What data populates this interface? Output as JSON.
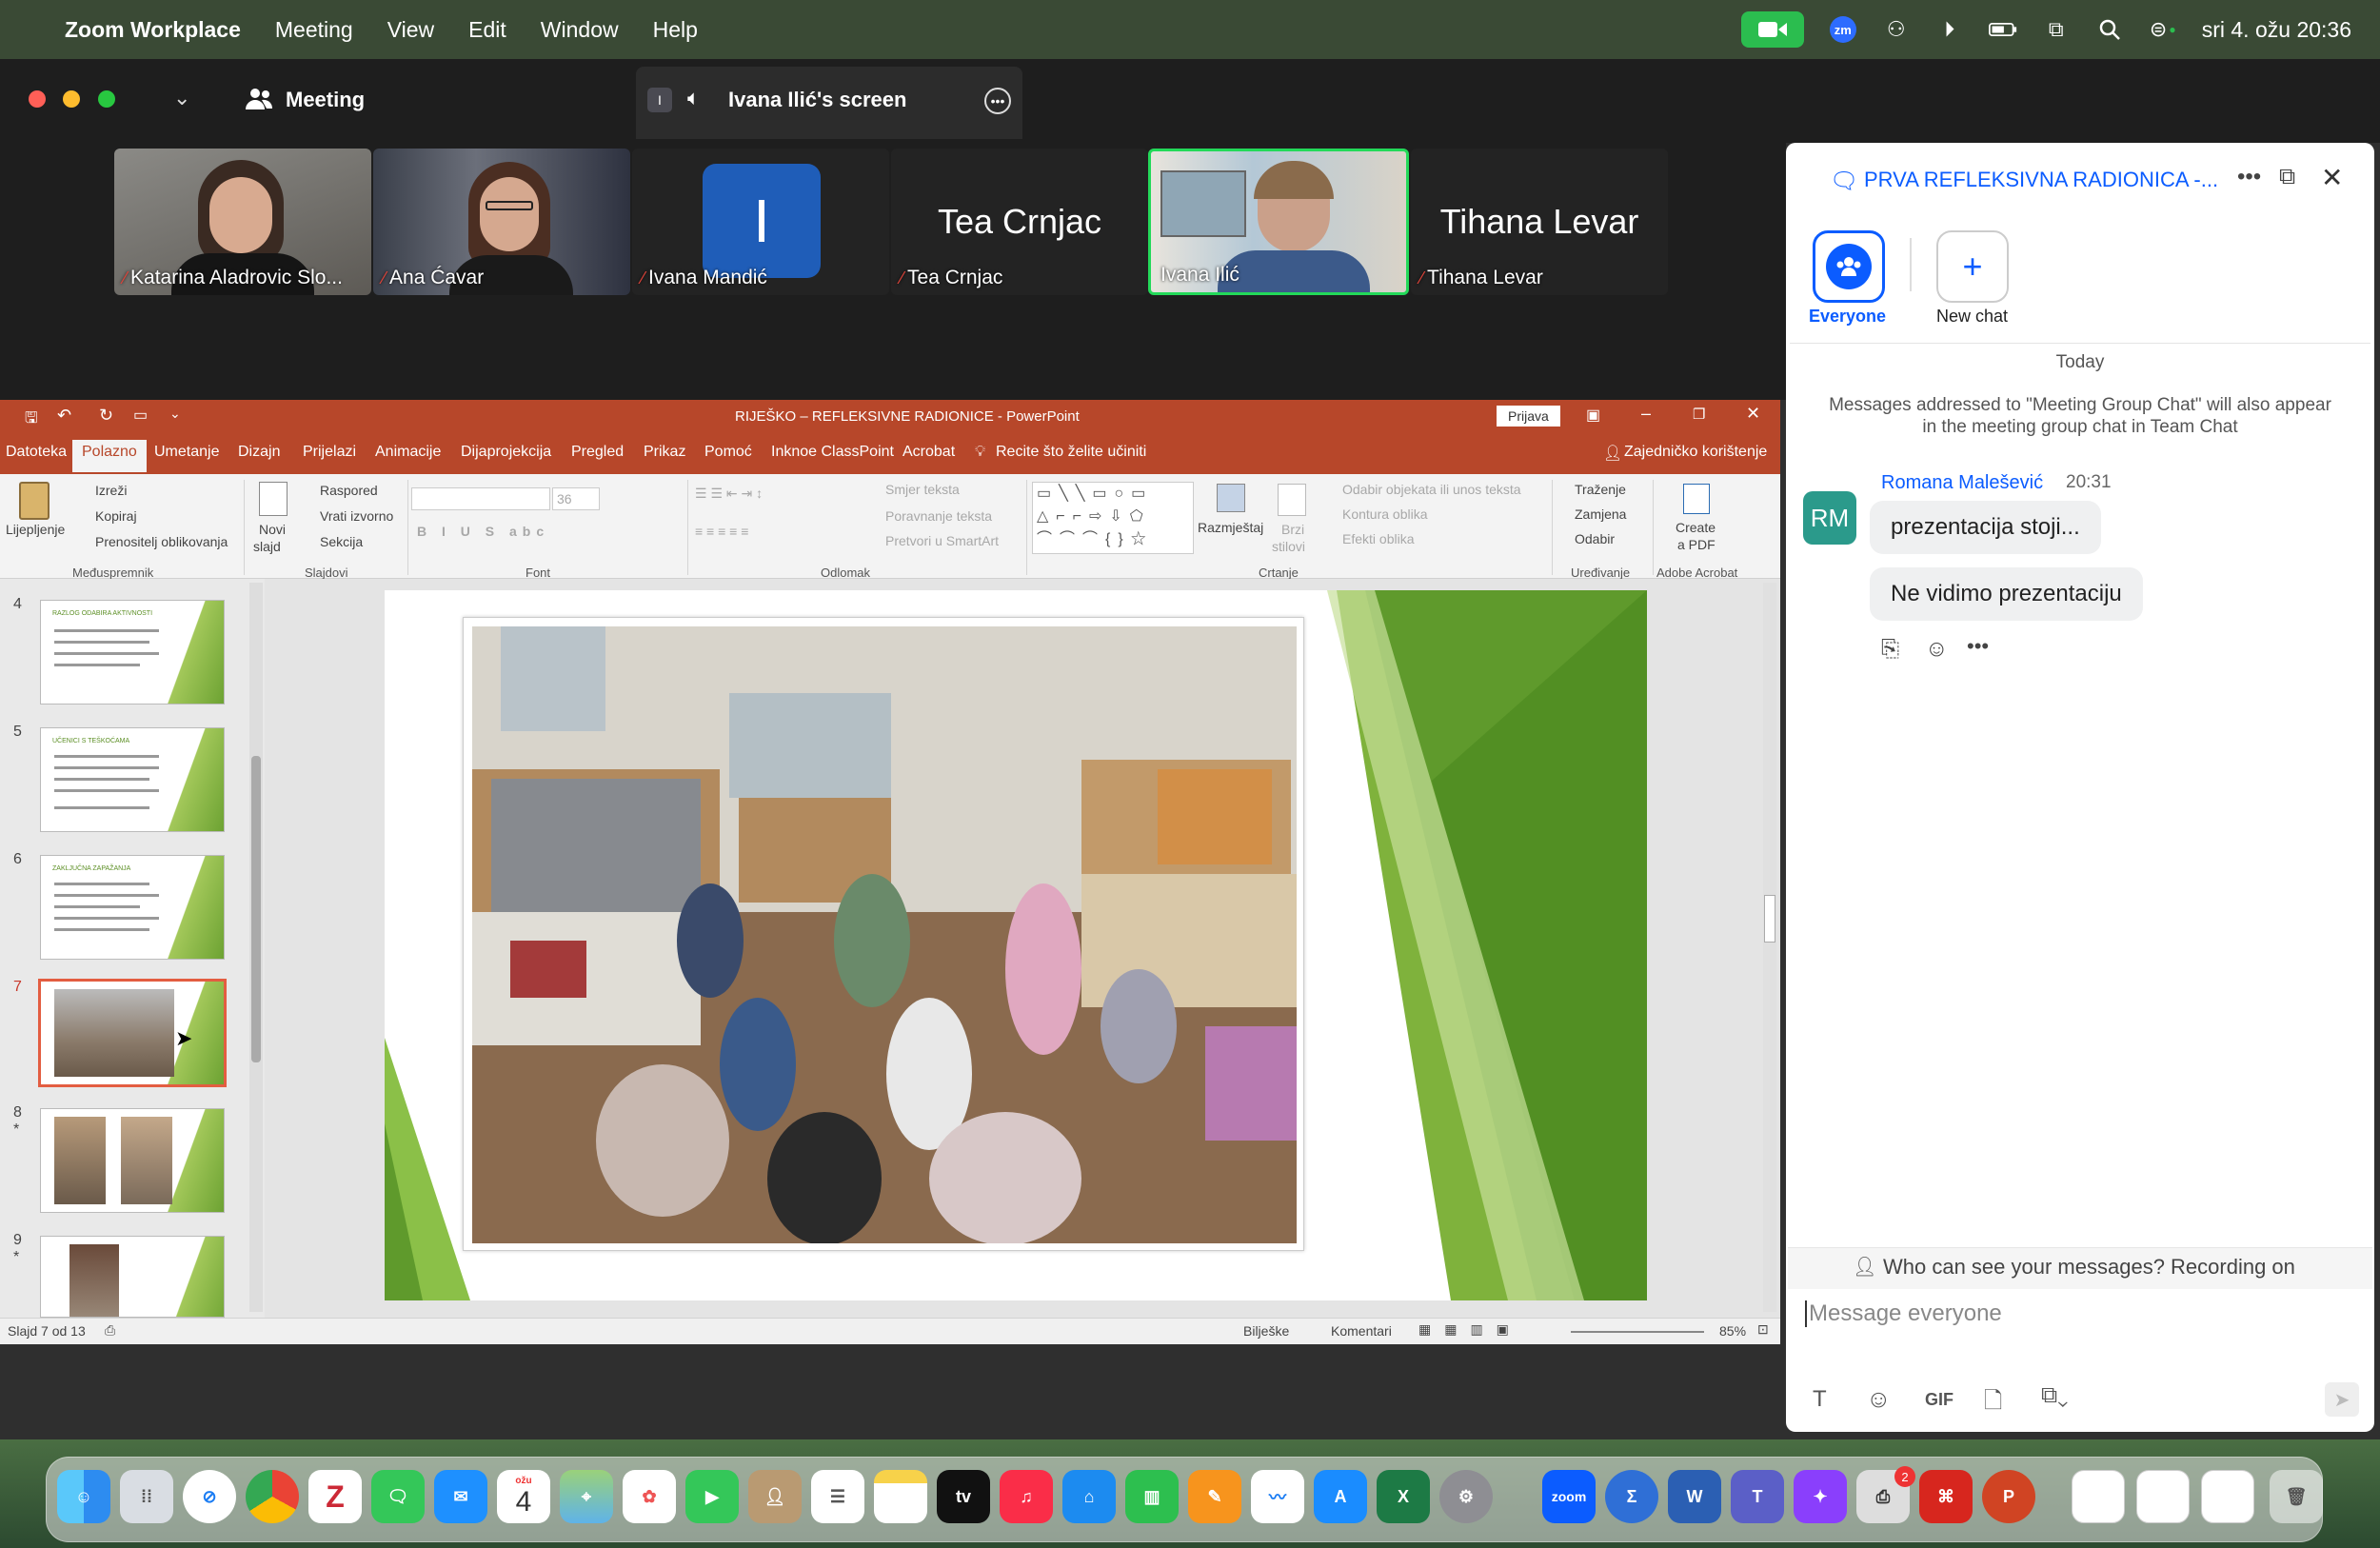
{
  "menubar": {
    "apple": "",
    "app_name": "Zoom Workplace",
    "menus": [
      "Meeting",
      "View",
      "Edit",
      "Window",
      "Help"
    ],
    "datetime": "sri 4. ožu 20:36"
  },
  "zoom_title": {
    "meeting_label": "Meeting",
    "share_badge": "I",
    "share_title": "Ivana Ilić's screen"
  },
  "participants": [
    {
      "name": "Katarina Aladrovic Slo...",
      "type": "video"
    },
    {
      "name": "Ana Ćavar",
      "type": "video"
    },
    {
      "name": "Ivana Mandić",
      "type": "avatar",
      "initial": "I"
    },
    {
      "name": "Tea Crnjac",
      "type": "text",
      "big_name": "Tea Crnjac"
    },
    {
      "name": "Ivana Ilić",
      "type": "video",
      "active": true
    },
    {
      "name": "Tihana Levar",
      "type": "text",
      "big_name": "Tihana Levar"
    }
  ],
  "ppt": {
    "title": "RIJEŠKO – REFLEKSIVNE RADIONICE  -  PowerPoint",
    "signin_button": "Prijava",
    "tabs": [
      "Datoteka",
      "Polazno",
      "Umetanje",
      "Dizajn",
      "Prijelazi",
      "Animacije",
      "Dijaprojekcija",
      "Pregled",
      "Prikaz",
      "Pomoć",
      "Inknoe ClassPoint",
      "Acrobat",
      "Recite što želite učiniti"
    ],
    "share_label": "Zajedničko korištenje",
    "ribbon": {
      "paste": "Lijepljenje",
      "cut": "Izreži",
      "copy": "Kopiraj",
      "format_painter": "Prenositelj oblikovanja",
      "new_slide_1": "Novi",
      "new_slide_2": "slajd",
      "layout": "Raspored",
      "reset": "Vrati izvorno",
      "section": "Sekcija",
      "font_size": "36",
      "text_direction": "Smjer teksta",
      "align_text": "Poravnanje teksta",
      "smartart": "Pretvori u SmartArt",
      "arrange": "Razmještaj",
      "quick_styles_1": "Brzi",
      "quick_styles_2": "stilovi",
      "shape_fill": "Odabir objekata ili unos teksta",
      "shape_outline": "Kontura oblika",
      "shape_effects": "Efekti oblika",
      "find": "Traženje",
      "replace": "Zamjena",
      "select": "Odabir",
      "create_pdf_1": "Create",
      "create_pdf_2": "a PDF",
      "groups": [
        "Međuspremnik",
        "Slajdovi",
        "Font",
        "Odlomak",
        "Crtanje",
        "Uređivanje",
        "Adobe Acrobat"
      ]
    },
    "slides": [
      {
        "num": "4",
        "title": "RAZLOG ODABIRA AKTIVNOSTI"
      },
      {
        "num": "5",
        "title": "UČENICI S TEŠKOĆAMA"
      },
      {
        "num": "6",
        "title": "ZAKLJUČNA ZAPAŽANJA"
      },
      {
        "num": "7",
        "title": ""
      },
      {
        "num": "8",
        "title": ""
      },
      {
        "num": "9",
        "title": ""
      }
    ],
    "status_left": "Slajd 7 od 13",
    "notes": "Bilješke",
    "comments": "Komentari",
    "zoom": "85%"
  },
  "chat": {
    "title": "PRVA REFLEKSIVNA RADIONICA -...",
    "everyone_label": "Everyone",
    "new_chat_label": "New chat",
    "date_divider": "Today",
    "notice": "Messages addressed to \"Meeting Group Chat\" will also appear in the meeting group chat in Team Chat",
    "sender_initials": "RM",
    "sender_name": "Romana Malešević",
    "time": "20:31",
    "messages": [
      "prezentacija stoji...",
      "Ne vidimo prezentaciju"
    ],
    "privacy": "Who can see your messages? Recording on",
    "input_placeholder": "Message everyone",
    "gif": "GIF"
  },
  "dock": {
    "calendar_month": "ožu",
    "calendar_day": "4",
    "tv": "tv",
    "zoom": "zoom",
    "badge": "2"
  },
  "colors": {
    "ppt_accent": "#b7472a",
    "zoom_blue": "#0b5cff",
    "slide_green": "#6ca232"
  }
}
